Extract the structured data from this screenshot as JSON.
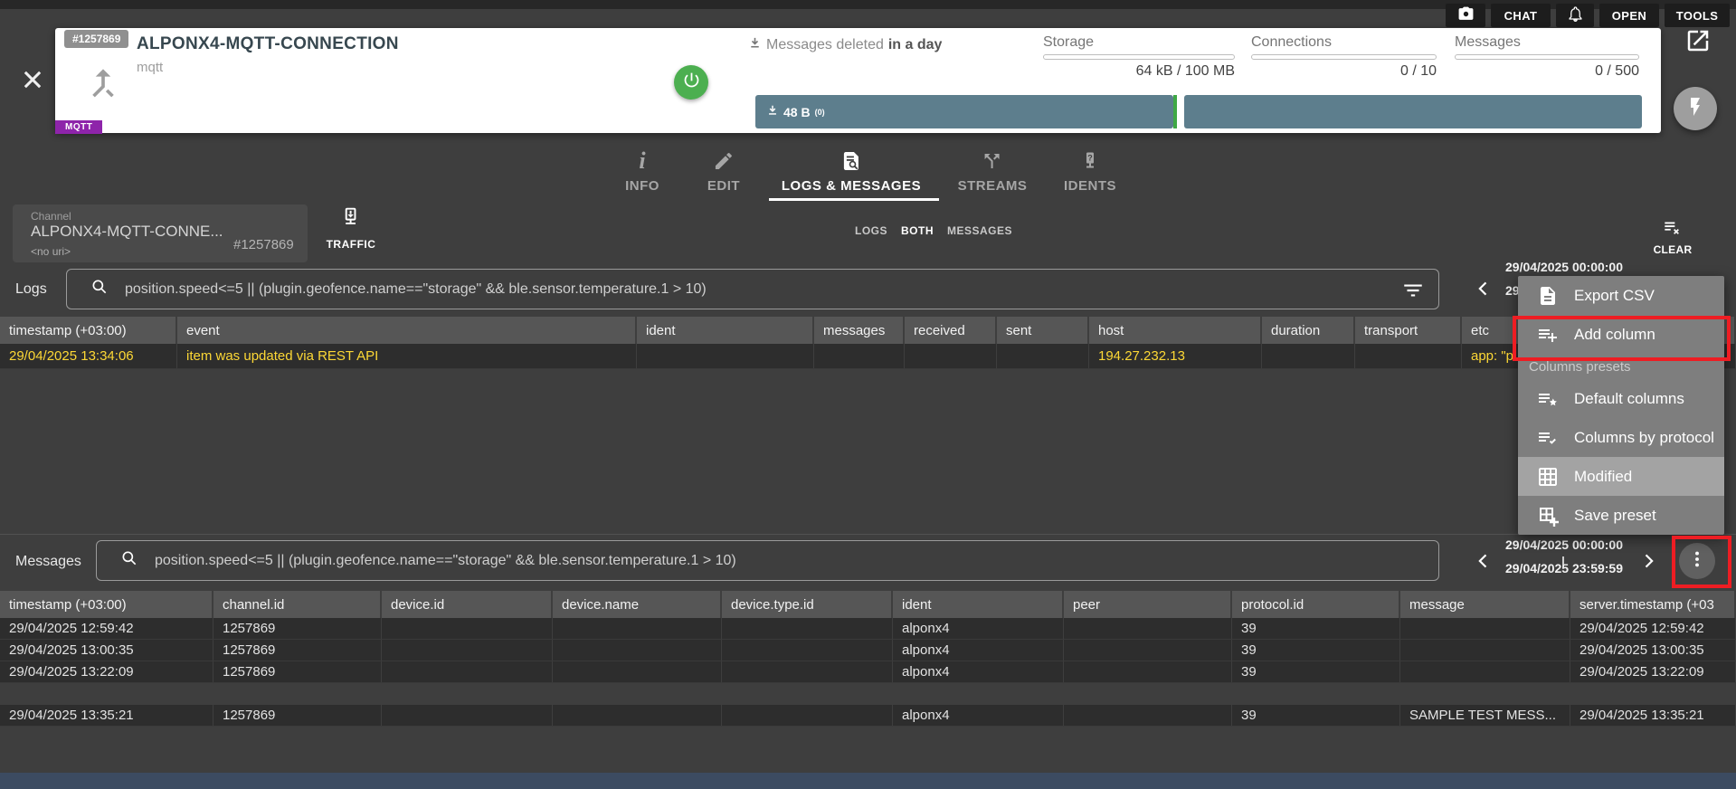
{
  "topbar": {
    "chat_label": "CHAT",
    "open_label": "OPEN",
    "tools_label": "TOOLS"
  },
  "header": {
    "id_badge": "#1257869",
    "title": "ALPONX4-MQTT-CONNECTION",
    "subtitle": "mqtt",
    "protocol_badge": "MQTT",
    "deleted_prefix": "Messages deleted",
    "deleted_value": "in a day",
    "buffer_size": "48 B",
    "buffer_count": "(0)",
    "meters": [
      {
        "label": "Storage",
        "value": "64 kB / 100 MB"
      },
      {
        "label": "Connections",
        "value": "0 / 10"
      },
      {
        "label": "Messages",
        "value": "0 / 500"
      }
    ]
  },
  "tabs": [
    {
      "label": "INFO",
      "active": false
    },
    {
      "label": "EDIT",
      "active": false
    },
    {
      "label": "LOGS & MESSAGES",
      "active": true
    },
    {
      "label": "STREAMS",
      "active": false
    },
    {
      "label": "IDENTS",
      "active": false
    }
  ],
  "toolbar": {
    "channel_label": "Channel",
    "channel_name": "ALPONX4-MQTT-CONNE...",
    "channel_id": "#1257869",
    "channel_uri": "<no uri>",
    "traffic_label": "TRAFFIC",
    "mode_segments": [
      "LOGS",
      "BOTH",
      "MESSAGES"
    ],
    "active_mode": "BOTH",
    "clear_label": "CLEAR"
  },
  "logs": {
    "label": "Logs",
    "search_query": "position.speed<=5 || (plugin.geofence.name==\"storage\" && ble.sensor.temperature.1 > 10)",
    "date_from": "29/04/2025 00:00:00",
    "date_to": "29/04/2025 23:59:59",
    "columns": [
      "timestamp (+03:00)",
      "event",
      "ident",
      "messages",
      "received",
      "sent",
      "host",
      "duration",
      "transport",
      "etc"
    ],
    "rows": [
      {
        "cells": [
          "29/04/2025 13:34:06",
          "item was updated via REST API",
          "",
          "",
          "",
          "",
          "194.27.232.13",
          "",
          "",
          "app: \"p"
        ]
      }
    ]
  },
  "column_menu": {
    "items": [
      {
        "label": "Export CSV",
        "icon": "file"
      },
      {
        "label": "Add column",
        "icon": "list-plus",
        "highlighted": true
      },
      {
        "label": "Columns presets",
        "type": "section"
      },
      {
        "label": "Default columns",
        "icon": "list-star"
      },
      {
        "label": "Columns by protocol",
        "icon": "list-check"
      },
      {
        "label": "Modified",
        "icon": "grid",
        "selected": true
      },
      {
        "label": "Save preset",
        "icon": "grid-plus"
      }
    ]
  },
  "messages": {
    "label": "Messages",
    "search_query": "position.speed<=5 || (plugin.geofence.name==\"storage\" && ble.sensor.temperature.1 > 10)",
    "date_from": "29/04/2025 00:00:00",
    "date_to": "29/04/2025 23:59:59",
    "columns": [
      "timestamp (+03:00)",
      "channel.id",
      "device.id",
      "device.name",
      "device.type.id",
      "ident",
      "peer",
      "protocol.id",
      "message",
      "server.timestamp (+03"
    ],
    "rows": [
      {
        "cells": [
          "29/04/2025 12:59:42",
          "1257869",
          "",
          "",
          "",
          "alponx4",
          "",
          "39",
          "",
          "29/04/2025 12:59:42"
        ]
      },
      {
        "cells": [
          "29/04/2025 13:00:35",
          "1257869",
          "",
          "",
          "",
          "alponx4",
          "",
          "39",
          "",
          "29/04/2025 13:00:35"
        ]
      },
      {
        "cells": [
          "29/04/2025 13:22:09",
          "1257869",
          "",
          "",
          "",
          "alponx4",
          "",
          "39",
          "",
          "29/04/2025 13:22:09"
        ]
      },
      {
        "cells": [
          "29/04/2025 13:35:21",
          "1257869",
          "",
          "",
          "",
          "alponx4",
          "",
          "39",
          "SAMPLE TEST MESS...",
          "29/04/2025 13:35:21"
        ],
        "gap_before": true
      }
    ]
  },
  "colors": {
    "annotation_red": "#ee1d23",
    "log_warning_text": "#fdd835",
    "buffer_teal": "#5d7e8d",
    "success_green": "#4caf50",
    "brand_purple": "#8e24aa",
    "footer_navy": "#3c4b61",
    "accent_white": "#ffffff"
  }
}
